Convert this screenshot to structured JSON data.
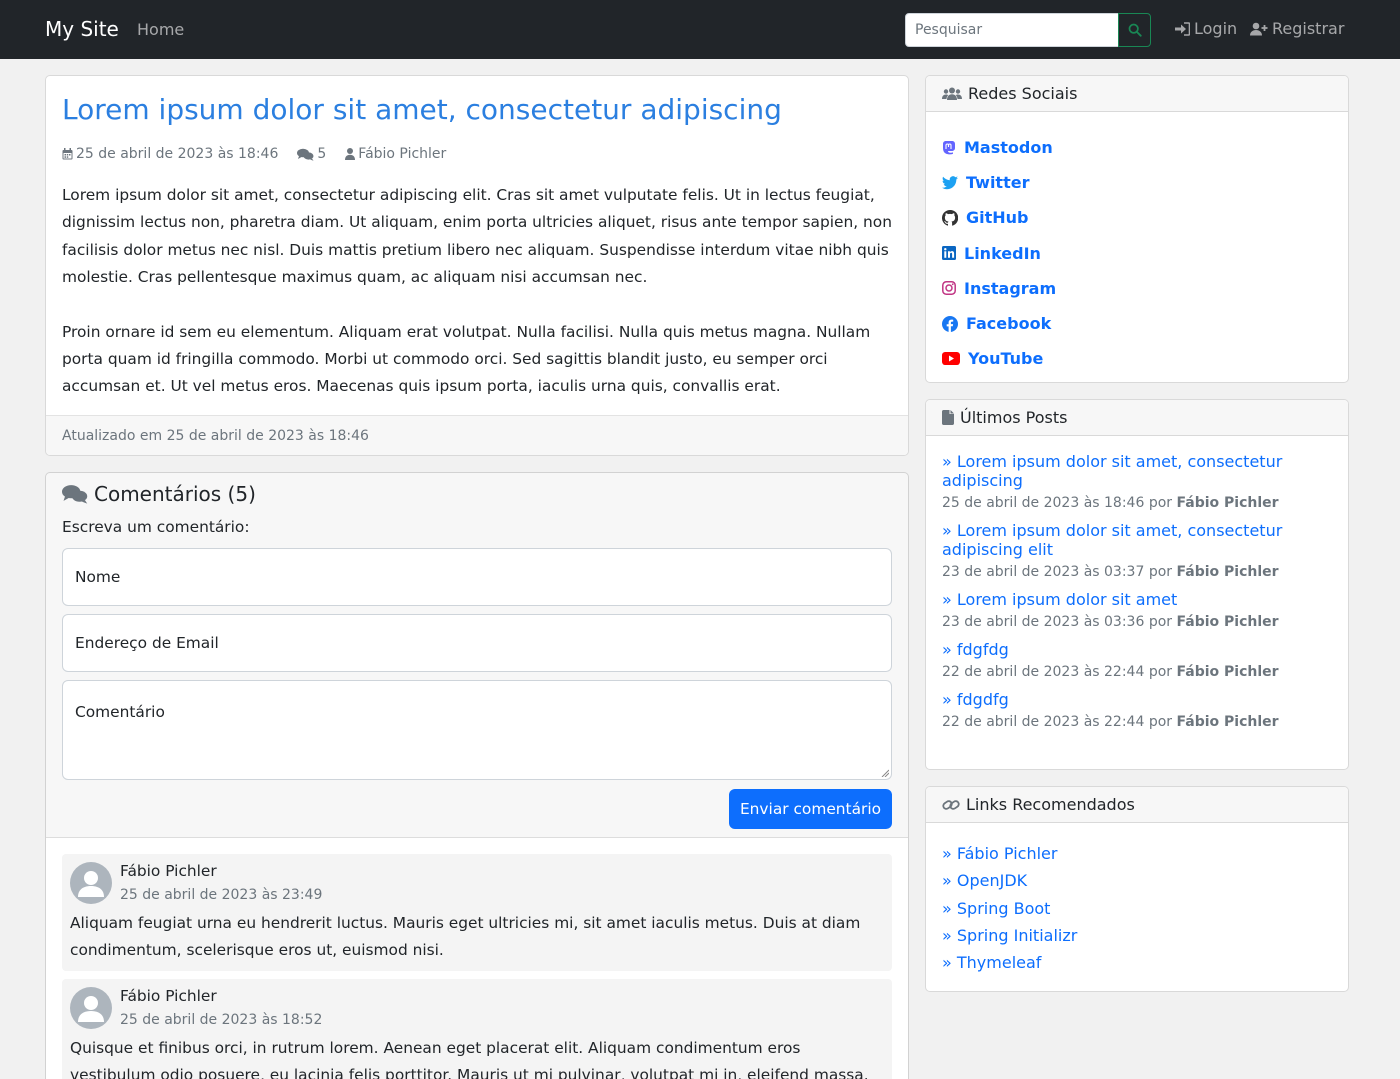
{
  "navbar": {
    "brand": "My Site",
    "home": "Home",
    "search_placeholder": "Pesquisar",
    "login": "Login",
    "register": "Registrar"
  },
  "post": {
    "title": "Lorem ipsum dolor sit amet, consectetur adipiscing",
    "date": "25 de abril de 2023 às 18:46",
    "comment_count": "5",
    "author": "Fábio Pichler",
    "paragraphs": [
      "Lorem ipsum dolor sit amet, consectetur adipiscing elit. Cras sit amet vulputate felis. Ut in lectus feugiat, dignissim lectus non, pharetra diam. Ut aliquam, enim porta ultricies aliquet, risus ante tempor sapien, non facilisis dolor metus nec nisl. Duis mattis pretium libero nec aliquam. Suspendisse interdum vitae nibh quis molestie. Cras pellentesque maximus quam, ac aliquam nisi accumsan nec.",
      "Proin ornare id sem eu elementum. Aliquam erat volutpat. Nulla facilisi. Nulla quis metus magna. Nullam porta quam id fringilla commodo. Morbi ut commodo orci. Sed sagittis blandit justo, eu semper orci accumsan et. Ut vel metus eros. Maecenas quis ipsum porta, iaculis urna quis, convallis erat."
    ],
    "updated": "Atualizado em 25 de abril de 2023 às 18:46"
  },
  "comments": {
    "title": "Comentários (5)",
    "prompt": "Escreva um comentário:",
    "name_placeholder": "Nome",
    "email_placeholder": "Endereço de Email",
    "comment_placeholder": "Comentário",
    "submit": "Enviar comentário",
    "items": [
      {
        "author": "Fábio Pichler",
        "date": "25 de abril de 2023 às 23:49",
        "text": "Aliquam feugiat urna eu hendrerit luctus. Mauris eget ultricies mi, sit amet iaculis metus. Duis at diam condimentum, scelerisque eros ut, euismod nisi."
      },
      {
        "author": "Fábio Pichler",
        "date": "25 de abril de 2023 às 18:52",
        "text": "Quisque et finibus orci, in rutrum lorem. Aenean eget placerat elit. Aliquam condimentum eros vestibulum odio posuere, eu lacinia felis porttitor. Mauris ut mi pulvinar, volutpat mi in, eleifend massa. Sed volutpat"
      }
    ]
  },
  "social": {
    "title": "Redes Sociais",
    "items": [
      {
        "label": "Mastodon",
        "icon": "mastodon-icon",
        "color": "#6364ff"
      },
      {
        "label": "Twitter",
        "icon": "twitter-icon",
        "color": "#1da1f2"
      },
      {
        "label": "GitHub",
        "icon": "github-icon",
        "color": "#333333"
      },
      {
        "label": "LinkedIn",
        "icon": "linkedin-icon",
        "color": "#0a66c2"
      },
      {
        "label": "Instagram",
        "icon": "instagram-icon",
        "color": "#c13584"
      },
      {
        "label": "Facebook",
        "icon": "facebook-icon",
        "color": "#1877f2"
      },
      {
        "label": "YouTube",
        "icon": "youtube-icon",
        "color": "#ff0000"
      }
    ]
  },
  "recent_posts": {
    "title": "Últimos Posts",
    "prefix": "»",
    "by": "por",
    "items": [
      {
        "title": "Lorem ipsum dolor sit amet, consectetur adipiscing",
        "date": "25 de abril de 2023 às 18:46",
        "author": "Fábio Pichler"
      },
      {
        "title": "Lorem ipsum dolor sit amet, consectetur adipiscing elit",
        "date": "23 de abril de 2023 às 03:37",
        "author": "Fábio Pichler"
      },
      {
        "title": "Lorem ipsum dolor sit amet",
        "date": "23 de abril de 2023 às 03:36",
        "author": "Fábio Pichler"
      },
      {
        "title": "fdgfdg",
        "date": "22 de abril de 2023 às 22:44",
        "author": "Fábio Pichler"
      },
      {
        "title": "fdgdfg",
        "date": "22 de abril de 2023 às 22:44",
        "author": "Fábio Pichler"
      }
    ]
  },
  "links": {
    "title": "Links Recomendados",
    "prefix": "»",
    "items": [
      "Fábio Pichler",
      "OpenJDK",
      "Spring Boot",
      "Spring Initializr",
      "Thymeleaf"
    ]
  },
  "colors": {
    "navbar_bg": "#212529",
    "link": "#0d6efd",
    "title": "#2b7fe0",
    "search_button_border": "#198754"
  }
}
